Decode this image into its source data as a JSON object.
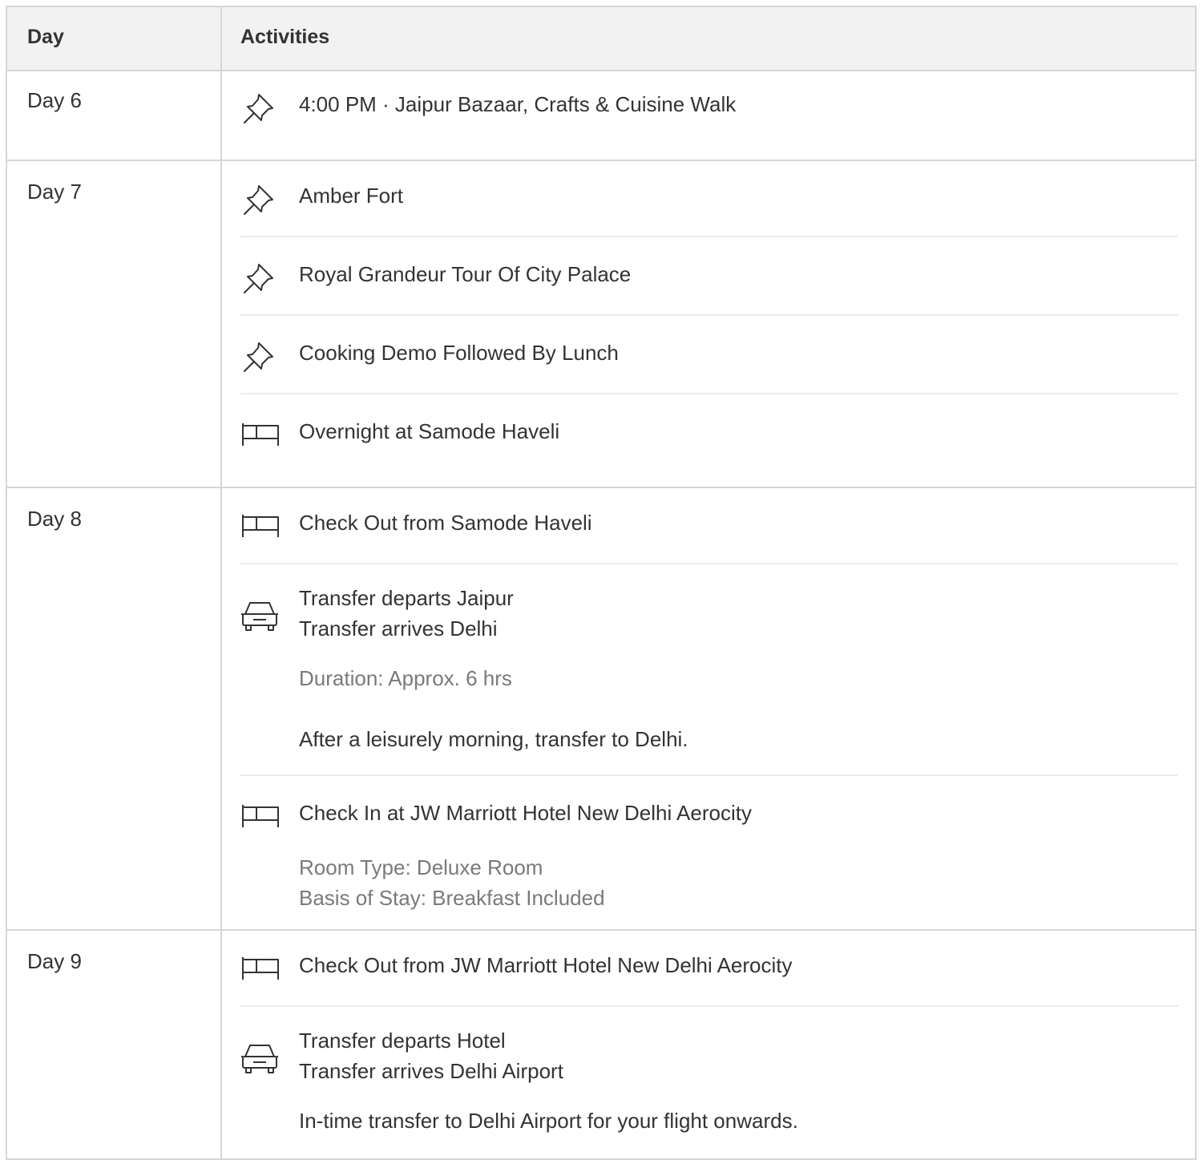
{
  "table": {
    "headers": {
      "day": "Day",
      "activities": "Activities"
    }
  },
  "days": [
    {
      "label": "Day 6",
      "items": [
        {
          "icon": "pushpin-icon",
          "lines": [
            "4:00 PM · Jaipur Bazaar, Crafts & Cuisine Walk"
          ]
        }
      ]
    },
    {
      "label": "Day 7",
      "items": [
        {
          "icon": "pushpin-icon",
          "lines": [
            "Amber Fort"
          ]
        },
        {
          "icon": "pushpin-icon",
          "lines": [
            "Royal Grandeur Tour Of City Palace"
          ]
        },
        {
          "icon": "pushpin-icon",
          "lines": [
            "Cooking Demo Followed By Lunch"
          ]
        },
        {
          "icon": "bed-icon",
          "lines": [
            "Overnight at Samode Haveli"
          ]
        }
      ]
    },
    {
      "label": "Day 8",
      "items": [
        {
          "icon": "bed-icon",
          "lines": [
            "Check Out from Samode Haveli"
          ]
        },
        {
          "icon": "car-icon",
          "lines": [
            "Transfer departs Jaipur",
            "Transfer arrives Delhi"
          ],
          "detail": [
            "Duration: Approx. 6 hrs"
          ],
          "note": "After a leisurely morning, transfer to Delhi."
        },
        {
          "icon": "bed-icon",
          "lines": [
            "Check In at JW Marriott Hotel New Delhi Aerocity"
          ],
          "detail": [
            "Room Type: Deluxe Room",
            "Basis of Stay: Breakfast Included"
          ]
        }
      ]
    },
    {
      "label": "Day 9",
      "items": [
        {
          "icon": "bed-icon",
          "lines": [
            "Check Out from JW Marriott Hotel New Delhi Aerocity"
          ]
        },
        {
          "icon": "car-icon",
          "lines": [
            "Transfer departs Hotel",
            "Transfer arrives Delhi Airport"
          ],
          "note": "In-time transfer to Delhi Airport for your flight onwards."
        }
      ]
    }
  ]
}
